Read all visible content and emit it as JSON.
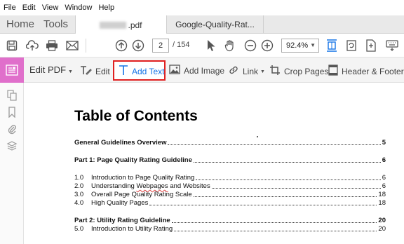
{
  "menu": [
    "File",
    "Edit",
    "View",
    "Window",
    "Help"
  ],
  "tabs": {
    "home": "Home",
    "tools": "Tools",
    "doc_active_suffix": ".pdf",
    "doc_inactive": "Google-Quality-Rat..."
  },
  "toolbar": {
    "page_current": "2",
    "page_total": "/ 154",
    "zoom": "92.4%"
  },
  "edit_toolbar": {
    "edit_pdf": "Edit PDF",
    "edit": "Edit",
    "add_text": "Add Text",
    "add_image": "Add Image",
    "link": "Link",
    "crop_pages": "Crop Pages",
    "header_footer": "Header & Footer",
    "highlight_color": "#e02020",
    "accent_color": "#1473e6",
    "mode_color": "#e06fcb"
  },
  "document": {
    "title": "Table of Contents",
    "entries": [
      {
        "label": "General Guidelines Overview",
        "page": "5",
        "bold": true
      },
      {
        "label": "Part 1: Page Quality Rating Guideline",
        "page": "6",
        "bold": true
      },
      {
        "num": "1.0",
        "label": "Introduction to Page Quality Rating",
        "page": "6"
      },
      {
        "num": "2.0",
        "label_pre": "Understanding ",
        "label_err": "Webpages",
        "label_post": " and Websites",
        "page": "6"
      },
      {
        "num": "3.0",
        "label": "Overall Page Quality Rating Scale",
        "page": "18"
      },
      {
        "num": "4.0",
        "label": "High Quality Pages",
        "page": "18"
      },
      {
        "label": "Part 2:  Utility Rating Guideline",
        "page": "20",
        "bold": true
      },
      {
        "num": "5.0",
        "label": "Introduction to Utility Rating",
        "page": "20"
      }
    ]
  }
}
